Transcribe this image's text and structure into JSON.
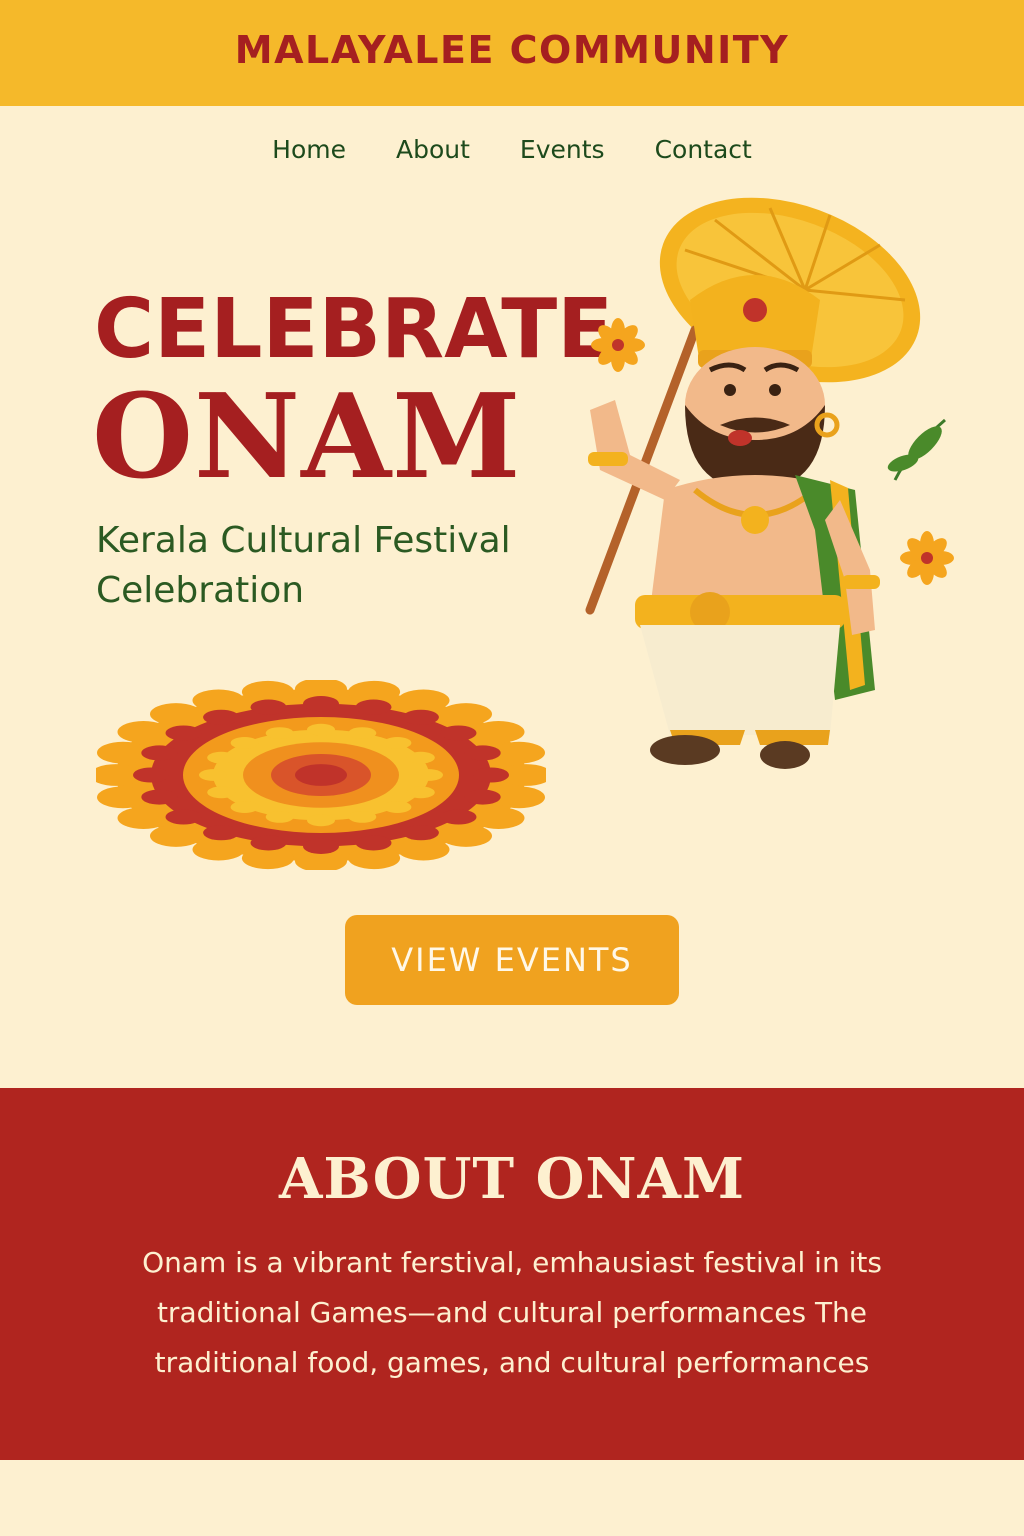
{
  "header": {
    "brand": "MALAYALEE COMMUNITY"
  },
  "nav": {
    "items": [
      "Home",
      "About",
      "Events",
      "Contact"
    ]
  },
  "hero": {
    "title_line1": "CELEBRATE",
    "title_line2": "ONAM",
    "subtitle": "Kerala Cultural Festival Celebration",
    "cta_label": "VIEW EVENTS",
    "illustration": "king-mahabali-with-umbrella",
    "decoration": "pookalam-flower-rangoli"
  },
  "about": {
    "title": "ABOUT ONAM",
    "body": "Onam is a vibrant ferstival, emhausiast festival in its traditional Games—and cultural performances The traditional food, games, and cultural performances"
  },
  "colors": {
    "background": "#fdf0d0",
    "header": "#f5b92a",
    "brand_red": "#a51f20",
    "nav_green": "#1d4a1c",
    "subtitle_green": "#2b5a22",
    "cta_orange": "#f0a21f",
    "about_red": "#b0251f"
  }
}
